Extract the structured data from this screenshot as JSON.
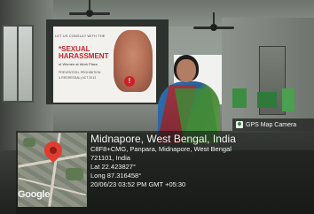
{
  "slide": {
    "top_text": "LET US CONSULT WITH THE",
    "title_line1": "*SEXUAL",
    "title_line2": "HARASSMENT",
    "subtitle": "of Women at Work Place",
    "line1": "PREVENTION, PROHIBITION",
    "line2": "& REDRESSAL) ACT 2013",
    "stop_symbol": "!"
  },
  "gps": {
    "tag_label": "GPS Map Camera",
    "tag_icon": "map-pin-icon",
    "map_brand": "Google",
    "location_title": "Midnapore, West Bengal, India",
    "address_line1": "C8F8+CMG, Panpara, Midnapore, West Bengal",
    "address_line2": "721101, India",
    "latitude": "Lat 22.423827°",
    "longitude": "Long 87.316458°",
    "datetime": "20/06/23 03:52 PM GMT +05:30"
  },
  "colors": {
    "pin": "#e03b2f",
    "slide_title": "#c8242a"
  }
}
